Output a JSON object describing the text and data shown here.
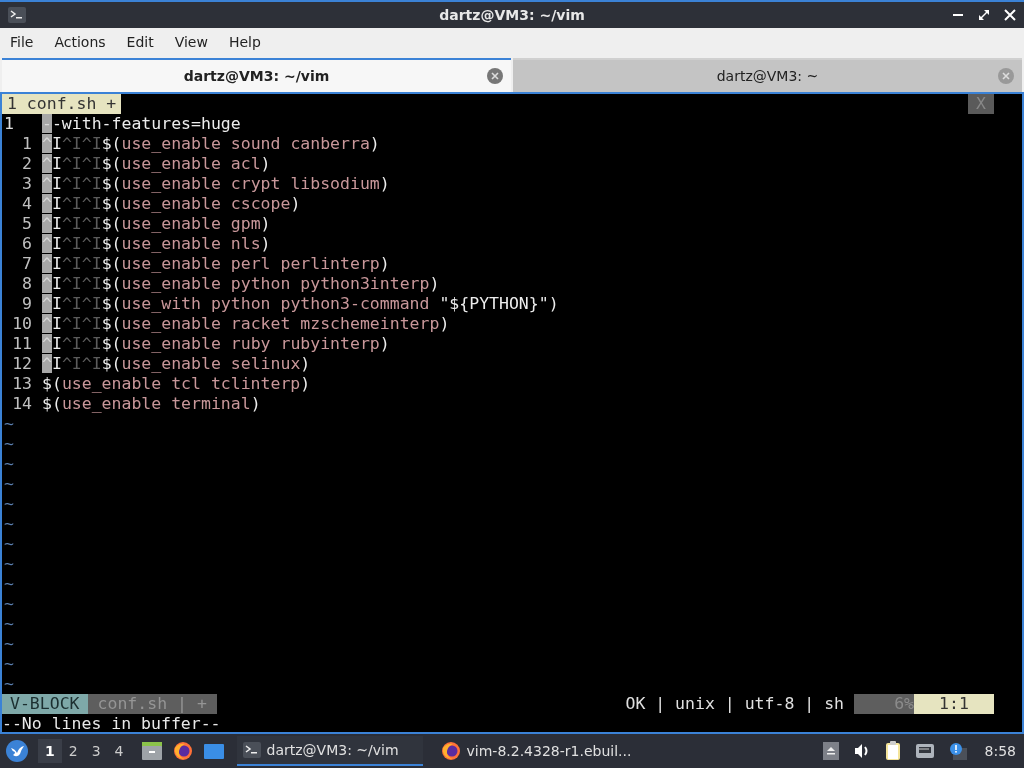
{
  "window": {
    "title": "dartz@VM3: ~/vim"
  },
  "menu": [
    "File",
    "Actions",
    "Edit",
    "View",
    "Help"
  ],
  "tabs": [
    {
      "label": "dartz@VM3: ~/vim",
      "selected": true
    },
    {
      "label": "dartz@VM3: ~",
      "selected": false
    }
  ],
  "vim": {
    "tabline": {
      "tab": "1 conf.sh +",
      "close": "X"
    },
    "lines": [
      {
        "number": "1",
        "current": true,
        "segments": [
          {
            "kind": "selected",
            "text": "-"
          },
          {
            "kind": "plain",
            "text": "-with-features=huge"
          }
        ]
      },
      {
        "number": "1",
        "current": false,
        "segments": [
          {
            "kind": "selected",
            "text": "^"
          },
          {
            "kind": "plain",
            "text": "I"
          },
          {
            "kind": "special",
            "text": "^I^I"
          },
          {
            "kind": "plain",
            "text": "$("
          },
          {
            "kind": "string",
            "text": "use_enable sound canberra"
          },
          {
            "kind": "plain",
            "text": ")"
          }
        ]
      },
      {
        "number": "2",
        "current": false,
        "segments": [
          {
            "kind": "selected",
            "text": "^"
          },
          {
            "kind": "plain",
            "text": "I"
          },
          {
            "kind": "special",
            "text": "^I^I"
          },
          {
            "kind": "plain",
            "text": "$("
          },
          {
            "kind": "string",
            "text": "use_enable acl"
          },
          {
            "kind": "plain",
            "text": ")"
          }
        ]
      },
      {
        "number": "3",
        "current": false,
        "segments": [
          {
            "kind": "selected",
            "text": "^"
          },
          {
            "kind": "plain",
            "text": "I"
          },
          {
            "kind": "special",
            "text": "^I^I"
          },
          {
            "kind": "plain",
            "text": "$("
          },
          {
            "kind": "string",
            "text": "use_enable crypt libsodium"
          },
          {
            "kind": "plain",
            "text": ")"
          }
        ]
      },
      {
        "number": "4",
        "current": false,
        "segments": [
          {
            "kind": "selected",
            "text": "^"
          },
          {
            "kind": "plain",
            "text": "I"
          },
          {
            "kind": "special",
            "text": "^I^I"
          },
          {
            "kind": "plain",
            "text": "$("
          },
          {
            "kind": "string",
            "text": "use_enable cscope"
          },
          {
            "kind": "plain",
            "text": ")"
          }
        ]
      },
      {
        "number": "5",
        "current": false,
        "segments": [
          {
            "kind": "selected",
            "text": "^"
          },
          {
            "kind": "plain",
            "text": "I"
          },
          {
            "kind": "special",
            "text": "^I^I"
          },
          {
            "kind": "plain",
            "text": "$("
          },
          {
            "kind": "string",
            "text": "use_enable gpm"
          },
          {
            "kind": "plain",
            "text": ")"
          }
        ]
      },
      {
        "number": "6",
        "current": false,
        "segments": [
          {
            "kind": "selected",
            "text": "^"
          },
          {
            "kind": "plain",
            "text": "I"
          },
          {
            "kind": "special",
            "text": "^I^I"
          },
          {
            "kind": "plain",
            "text": "$("
          },
          {
            "kind": "string",
            "text": "use_enable nls"
          },
          {
            "kind": "plain",
            "text": ")"
          }
        ]
      },
      {
        "number": "7",
        "current": false,
        "segments": [
          {
            "kind": "selected",
            "text": "^"
          },
          {
            "kind": "plain",
            "text": "I"
          },
          {
            "kind": "special",
            "text": "^I^I"
          },
          {
            "kind": "plain",
            "text": "$("
          },
          {
            "kind": "string",
            "text": "use_enable perl perlinterp"
          },
          {
            "kind": "plain",
            "text": ")"
          }
        ]
      },
      {
        "number": "8",
        "current": false,
        "segments": [
          {
            "kind": "selected",
            "text": "^"
          },
          {
            "kind": "plain",
            "text": "I"
          },
          {
            "kind": "special",
            "text": "^I^I"
          },
          {
            "kind": "plain",
            "text": "$("
          },
          {
            "kind": "string",
            "text": "use_enable python python3interp"
          },
          {
            "kind": "plain",
            "text": ")"
          }
        ]
      },
      {
        "number": "9",
        "current": false,
        "segments": [
          {
            "kind": "selected",
            "text": "^"
          },
          {
            "kind": "plain",
            "text": "I"
          },
          {
            "kind": "special",
            "text": "^I^I"
          },
          {
            "kind": "plain",
            "text": "$("
          },
          {
            "kind": "string",
            "text": "use_with python python3-command "
          },
          {
            "kind": "plain",
            "text": "\"${PYTHON}\")"
          }
        ]
      },
      {
        "number": "10",
        "current": false,
        "segments": [
          {
            "kind": "selected",
            "text": "^"
          },
          {
            "kind": "plain",
            "text": "I"
          },
          {
            "kind": "special",
            "text": "^I^I"
          },
          {
            "kind": "plain",
            "text": "$("
          },
          {
            "kind": "string",
            "text": "use_enable racket mzschemeinterp"
          },
          {
            "kind": "plain",
            "text": ")"
          }
        ]
      },
      {
        "number": "11",
        "current": false,
        "segments": [
          {
            "kind": "selected",
            "text": "^"
          },
          {
            "kind": "plain",
            "text": "I"
          },
          {
            "kind": "special",
            "text": "^I^I"
          },
          {
            "kind": "plain",
            "text": "$("
          },
          {
            "kind": "string",
            "text": "use_enable ruby rubyinterp"
          },
          {
            "kind": "plain",
            "text": ")"
          }
        ]
      },
      {
        "number": "12",
        "current": false,
        "segments": [
          {
            "kind": "selected",
            "text": "^"
          },
          {
            "kind": "plain",
            "text": "I"
          },
          {
            "kind": "special",
            "text": "^I^I"
          },
          {
            "kind": "plain",
            "text": "$("
          },
          {
            "kind": "string",
            "text": "use_enable selinux"
          },
          {
            "kind": "plain",
            "text": ")"
          }
        ]
      },
      {
        "number": "13",
        "current": false,
        "segments": [
          {
            "kind": "plain",
            "text": "$("
          },
          {
            "kind": "string",
            "text": "use_enable tcl tclinterp"
          },
          {
            "kind": "plain",
            "text": ")"
          }
        ]
      },
      {
        "number": "14",
        "current": false,
        "segments": [
          {
            "kind": "plain",
            "text": "$("
          },
          {
            "kind": "string",
            "text": "use_enable terminal"
          },
          {
            "kind": "plain",
            "text": ")"
          }
        ]
      }
    ],
    "filler_lines": [
      "~",
      "~",
      "~",
      "~",
      "~",
      "~",
      "~",
      "~",
      "~",
      "~",
      "~",
      "~",
      "~",
      "~"
    ],
    "statusline": {
      "mode": "V-BLOCK",
      "file": "conf.sh | +",
      "info": "OK | unix | utf-8 | sh",
      "percent": "6%",
      "position": "1:1"
    },
    "message": "--No lines in buffer--"
  },
  "taskbar": {
    "workspaces": [
      {
        "label": "1",
        "selected": true
      },
      {
        "label": "2",
        "selected": false
      },
      {
        "label": "3",
        "selected": false
      },
      {
        "label": "4",
        "selected": false
      }
    ],
    "tasks": [
      {
        "kind": "terminal",
        "title": "dartz@VM3: ~/vim",
        "active": true
      },
      {
        "kind": "browser",
        "title": "vim-8.2.4328-r1.ebuil...",
        "active": false
      }
    ],
    "clock": "8:58"
  }
}
